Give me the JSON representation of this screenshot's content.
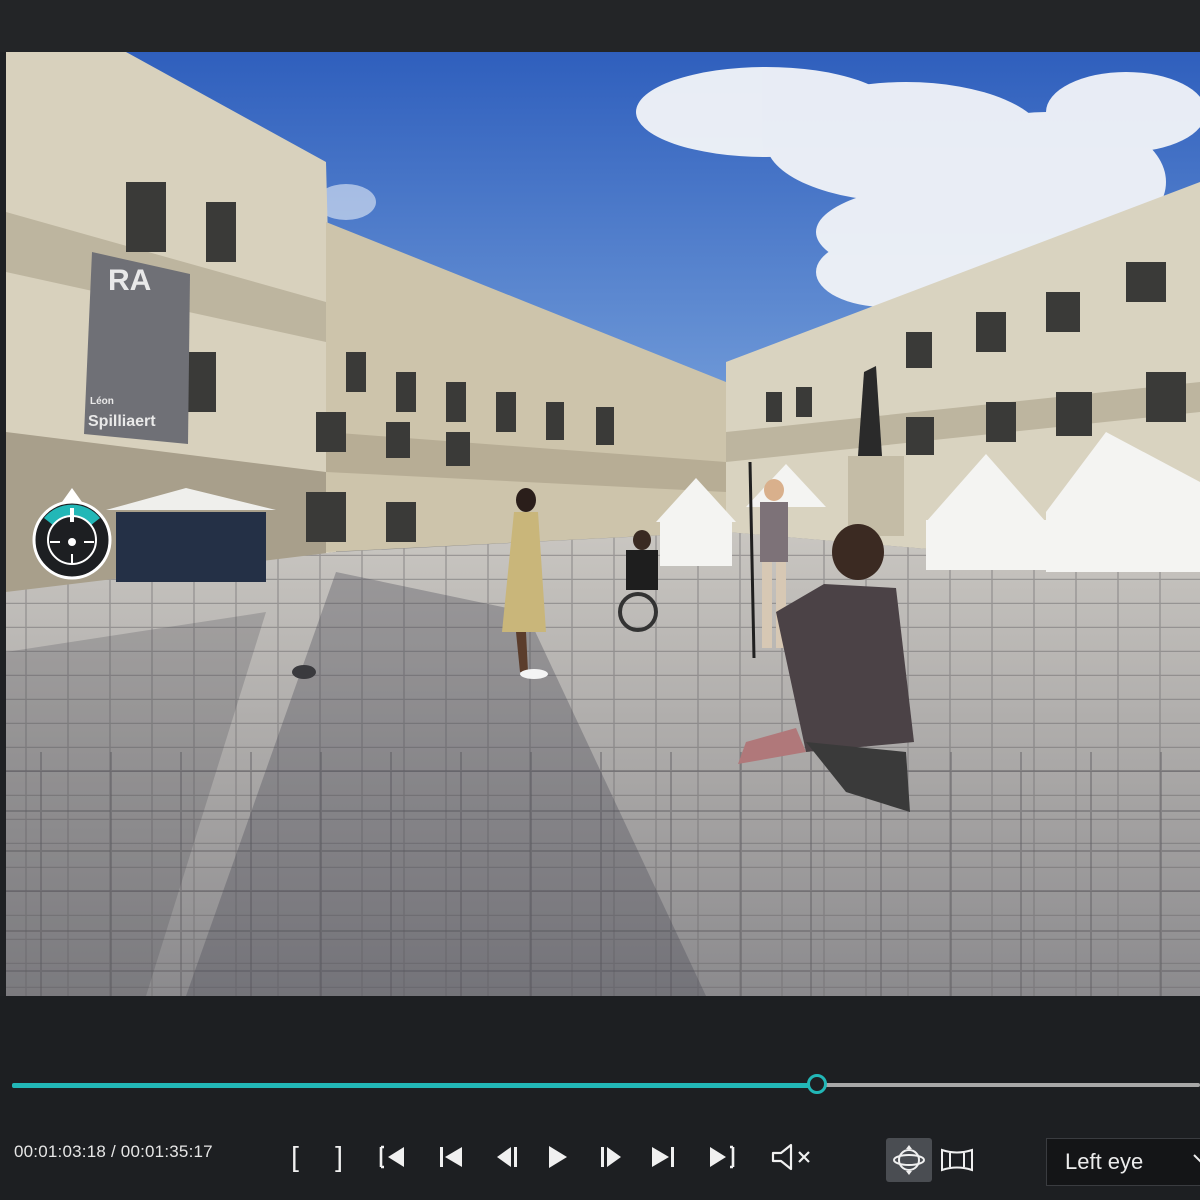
{
  "video": {
    "banner_text_top": "RA",
    "banner_text_name": "Spilliaert",
    "banner_text_small": "Léon"
  },
  "playback": {
    "current_time": "00:01:03:18",
    "separator": " / ",
    "duration": "00:01:35:17",
    "progress_fraction": 0.678
  },
  "controls": {
    "mark_in": "[",
    "mark_out": "]",
    "buttons": [
      {
        "name": "go-to-in-point-icon"
      },
      {
        "name": "step-back-icon"
      },
      {
        "name": "frame-back-icon"
      },
      {
        "name": "play-icon"
      },
      {
        "name": "frame-forward-icon"
      },
      {
        "name": "step-forward-icon"
      },
      {
        "name": "go-to-out-point-icon"
      },
      {
        "name": "mute-icon"
      }
    ]
  },
  "view": {
    "modes": [
      "360-view-icon",
      "panorama-view-icon"
    ],
    "eye_select": {
      "selected": "Left eye"
    }
  },
  "colors": {
    "accent": "#22b7b7",
    "background": "#1f2124"
  }
}
